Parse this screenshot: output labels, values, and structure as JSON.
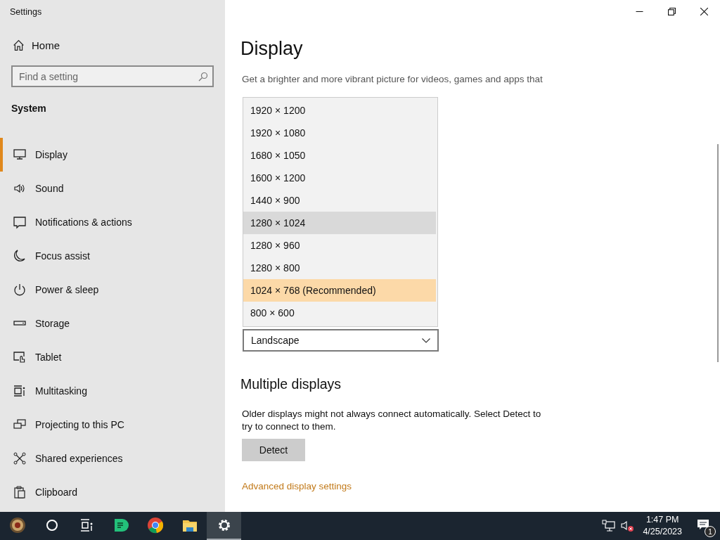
{
  "window": {
    "title": "Settings"
  },
  "sidebar": {
    "home": "Home",
    "search": {
      "placeholder": "Find a setting"
    },
    "section": "System",
    "items": [
      {
        "label": "Display",
        "selected": true
      },
      {
        "label": "Sound",
        "selected": false
      },
      {
        "label": "Notifications & actions",
        "selected": false
      },
      {
        "label": "Focus assist",
        "selected": false
      },
      {
        "label": "Power & sleep",
        "selected": false
      },
      {
        "label": "Storage",
        "selected": false
      },
      {
        "label": "Tablet",
        "selected": false
      },
      {
        "label": "Multitasking",
        "selected": false
      },
      {
        "label": "Projecting to this PC",
        "selected": false
      },
      {
        "label": "Shared experiences",
        "selected": false
      },
      {
        "label": "Clipboard",
        "selected": false
      }
    ]
  },
  "main": {
    "title": "Display",
    "description": "Get a brighter and more vibrant picture for videos, games and apps that",
    "resolution_dropdown": [
      {
        "label": "1920 × 1200",
        "selected": false,
        "hovered": false
      },
      {
        "label": "1920 × 1080",
        "selected": false,
        "hovered": false
      },
      {
        "label": "1680 × 1050",
        "selected": false,
        "hovered": false
      },
      {
        "label": "1600 × 1200",
        "selected": false,
        "hovered": false
      },
      {
        "label": "1440 × 900",
        "selected": false,
        "hovered": false
      },
      {
        "label": "1280 × 1024",
        "selected": false,
        "hovered": true
      },
      {
        "label": "1280 × 960",
        "selected": false,
        "hovered": false
      },
      {
        "label": "1280 × 800",
        "selected": false,
        "hovered": false
      },
      {
        "label": "1024 × 768 (Recommended)",
        "selected": true,
        "hovered": false
      },
      {
        "label": "800 × 600",
        "selected": false,
        "hovered": false
      }
    ],
    "orientation": {
      "value": "Landscape"
    },
    "multiple_displays": {
      "title": "Multiple displays",
      "text": "Older displays might not always connect automatically. Select Detect to try to connect to them.",
      "button": "Detect"
    },
    "link": "Advanced display settings"
  },
  "taskbar": {
    "apps": [
      {
        "selected": false
      },
      {
        "selected": false
      },
      {
        "selected": false
      },
      {
        "selected": false
      },
      {
        "selected": false
      },
      {
        "selected": false
      },
      {
        "selected": true
      }
    ],
    "time": "1:47 PM",
    "date": "4/25/2023",
    "notifications": "1"
  }
}
